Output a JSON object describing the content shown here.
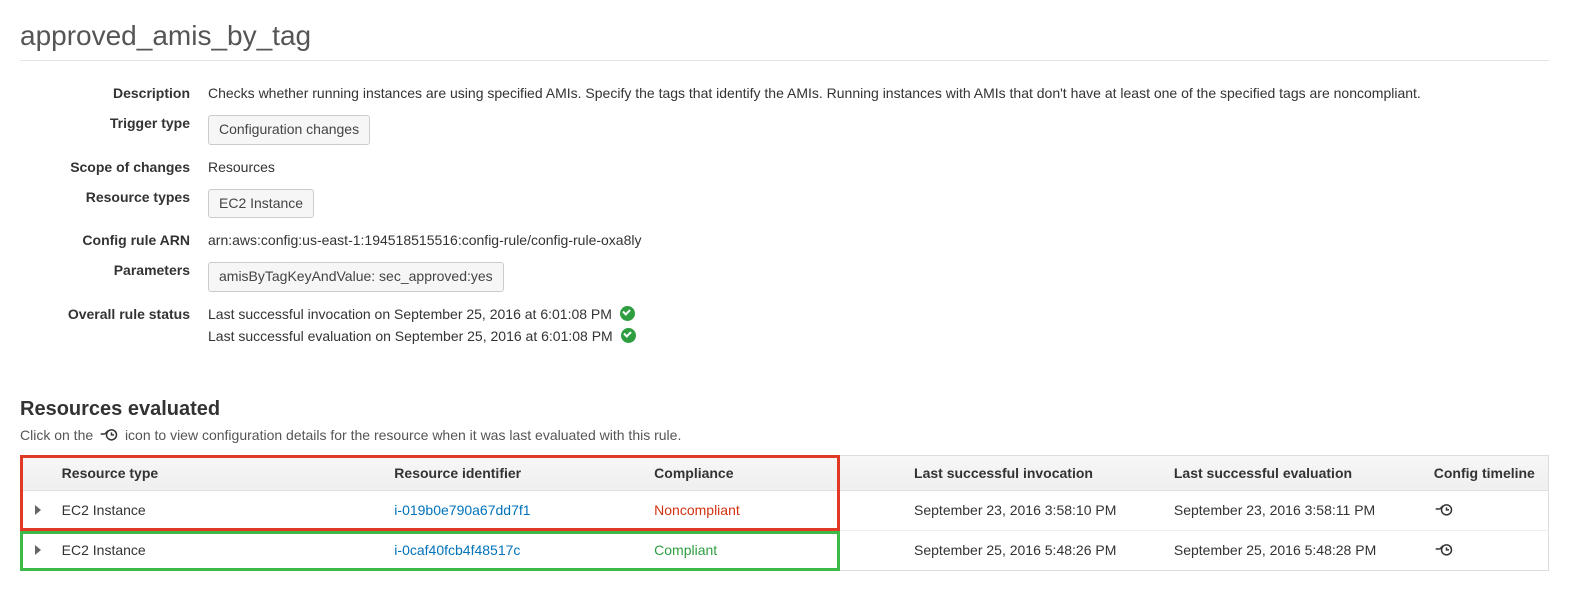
{
  "title": "approved_amis_by_tag",
  "details": {
    "labels": {
      "description": "Description",
      "trigger_type": "Trigger type",
      "scope": "Scope of changes",
      "resource_types": "Resource types",
      "arn": "Config rule ARN",
      "parameters": "Parameters",
      "overall_status": "Overall rule status"
    },
    "description": "Checks whether running instances are using specified AMIs. Specify the tags that identify the AMIs. Running instances with AMIs that don't have at least one of the specified tags are noncompliant.",
    "trigger_type": "Configuration changes",
    "scope": "Resources",
    "resource_types": "EC2 Instance",
    "arn": "arn:aws:config:us-east-1:194518515516:config-rule/config-rule-oxa8ly",
    "parameters": "amisByTagKeyAndValue: sec_approved:yes",
    "overall_status": {
      "invocation": "Last successful invocation on September 25, 2016 at 6:01:08 PM",
      "evaluation": "Last successful evaluation on September 25, 2016 at 6:01:08 PM"
    }
  },
  "resources": {
    "title": "Resources evaluated",
    "hint_pre": "Click on the ",
    "hint_post": " icon to view configuration details for the resource when it was last evaluated with this rule.",
    "columns": {
      "resource_type": "Resource type",
      "resource_identifier": "Resource identifier",
      "compliance": "Compliance",
      "last_invocation": "Last successful invocation",
      "last_evaluation": "Last successful evaluation",
      "config_timeline": "Config timeline"
    },
    "rows": [
      {
        "resource_type": "EC2 Instance",
        "resource_identifier": "i-019b0e790a67dd7f1",
        "compliance": "Noncompliant",
        "compliance_state": "noncompliant",
        "last_invocation": "September 23, 2016 3:58:10 PM",
        "last_evaluation": "September 23, 2016 3:58:11 PM"
      },
      {
        "resource_type": "EC2 Instance",
        "resource_identifier": "i-0caf40fcb4f48517c",
        "compliance": "Compliant",
        "compliance_state": "compliant",
        "last_invocation": "September 25, 2016 5:48:26 PM",
        "last_evaluation": "September 25, 2016 5:48:28 PM"
      }
    ]
  }
}
